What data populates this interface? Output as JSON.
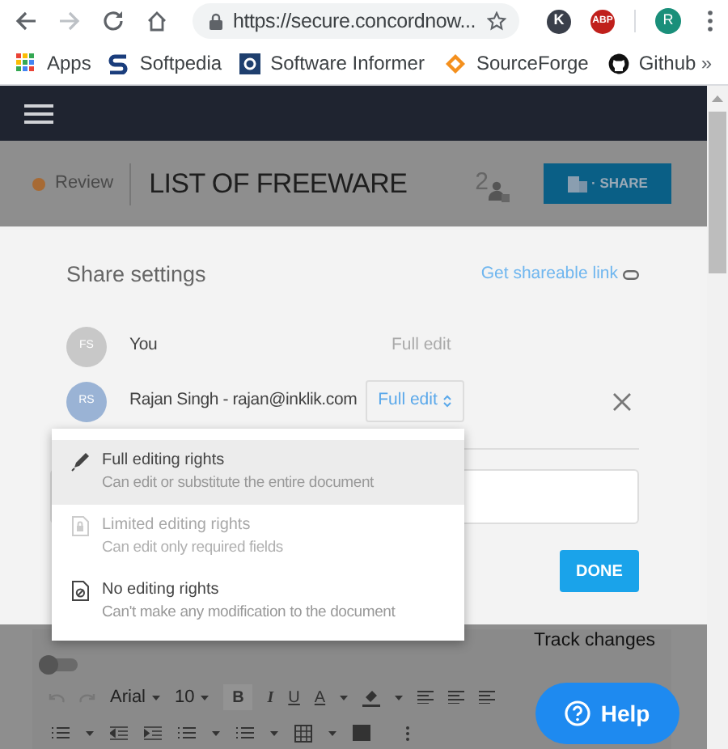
{
  "browser": {
    "url": "https://secure.concordnow...",
    "extensions": [
      {
        "label": "K",
        "color": "#3a3f4a"
      },
      {
        "label": "ABP",
        "color": "#c0201c"
      }
    ],
    "profile": "R",
    "bookmarks": [
      {
        "label": "Apps",
        "kind": "apps"
      },
      {
        "label": "Softpedia",
        "kind": "softpedia"
      },
      {
        "label": "Software Informer",
        "kind": "informer"
      },
      {
        "label": "SourceForge",
        "kind": "sourceforge"
      },
      {
        "label": "Github",
        "kind": "github"
      }
    ],
    "overflow": "»"
  },
  "document": {
    "status": "Review",
    "title": "LIST OF FREEWARE",
    "collaborators": "2",
    "share_button": "· SHARE"
  },
  "share_dialog": {
    "title": "Share settings",
    "link": "Get shareable link",
    "members": [
      {
        "initials": "FS",
        "name": "You",
        "permission": "Full edit",
        "kind": "owner",
        "color": "#c8c8c8"
      },
      {
        "initials": "RS",
        "name": "Rajan Singh - rajan@inklik.com",
        "permission": "Full edit",
        "kind": "editable",
        "color": "#9ab3d5"
      }
    ],
    "done_button": "DONE"
  },
  "permission_menu": [
    {
      "title": "Full editing rights",
      "description": "Can edit or substitute the entire document",
      "kind": "pencil",
      "selected": true,
      "disabled": false
    },
    {
      "title": "Limited editing rights",
      "description": "Can edit only required fields",
      "kind": "lock",
      "selected": false,
      "disabled": true
    },
    {
      "title": "No editing rights",
      "description": "Can't make any modification to the document",
      "kind": "blocked",
      "selected": false,
      "disabled": false
    }
  ],
  "editor": {
    "track_changes": "Track changes",
    "track_changes_on": false,
    "font": "Arial",
    "font_size": "10",
    "bold": "B",
    "italic": "I",
    "underline": "U",
    "text_color": "A"
  },
  "help_button": "Help"
}
